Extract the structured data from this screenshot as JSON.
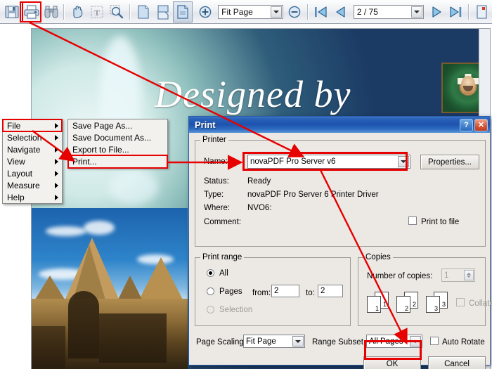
{
  "toolbar": {
    "icons": [
      {
        "name": "save-icon",
        "title": "Save"
      },
      {
        "name": "print-icon",
        "title": "Print"
      },
      {
        "name": "find-binoculars-icon",
        "title": "Find"
      },
      {
        "name": "hand-pan-icon",
        "title": "Pan"
      },
      {
        "name": "text-select-icon",
        "title": "Select Text"
      },
      {
        "name": "zoom-marquee-icon",
        "title": "Zoom"
      },
      {
        "name": "page-view-icon",
        "title": "Single Page"
      },
      {
        "name": "continuous-view-icon",
        "title": "Continuous"
      },
      {
        "name": "facing-view-icon",
        "title": "Facing"
      },
      {
        "name": "zoom-in-icon",
        "title": "Zoom In"
      },
      {
        "name": "zoom-out-icon",
        "title": "Zoom Out"
      },
      {
        "name": "first-page-icon",
        "title": "First Page"
      },
      {
        "name": "previous-page-icon",
        "title": "Previous Page"
      },
      {
        "name": "next-page-icon",
        "title": "Next Page"
      },
      {
        "name": "last-page-icon",
        "title": "Last Page"
      }
    ],
    "zoom_value": "Fit Page",
    "page_value": "2 / 75"
  },
  "document": {
    "heading": "Designed by"
  },
  "context_menu": {
    "main_items": [
      {
        "label": "File",
        "has_submenu": true,
        "highlighted": true
      },
      {
        "label": "Selection",
        "has_submenu": true,
        "highlighted": false
      },
      {
        "label": "Navigate",
        "has_submenu": true,
        "highlighted": false
      },
      {
        "label": "View",
        "has_submenu": true,
        "highlighted": false
      },
      {
        "label": "Layout",
        "has_submenu": true,
        "highlighted": false
      },
      {
        "label": "Measure",
        "has_submenu": true,
        "highlighted": false
      },
      {
        "label": "Help",
        "has_submenu": true,
        "highlighted": false
      }
    ],
    "sub_items": [
      {
        "label": "Save Page As...",
        "highlighted": false
      },
      {
        "label": "Save Document As...",
        "highlighted": false
      },
      {
        "label": "Export to File...",
        "highlighted": false
      },
      {
        "label": "Print...",
        "highlighted": true
      }
    ]
  },
  "dialog": {
    "title": "Print",
    "help_button": "?",
    "close_button": "✕",
    "printer": {
      "legend": "Printer",
      "name_label": "Name:",
      "name_value": "novaPDF Pro Server v6",
      "properties_button": "Properties...",
      "status_label": "Status:",
      "status_value": "Ready",
      "type_label": "Type:",
      "type_value": "novaPDF Pro Server 6 Printer Driver",
      "where_label": "Where:",
      "where_value": "NVO6:",
      "comment_label": "Comment:",
      "comment_value": "",
      "print_to_file_label": "Print to file",
      "print_to_file_checked": false
    },
    "print_range": {
      "legend": "Print range",
      "all_label": "All",
      "all_selected": true,
      "pages_label": "Pages",
      "pages_selected": false,
      "from_label": "from:",
      "from_value": "2",
      "to_label": "to:",
      "to_value": "2",
      "selection_label": "Selection",
      "selection_selected": false,
      "selection_disabled": true
    },
    "copies": {
      "legend": "Copies",
      "number_label": "Number of copies:",
      "number_value": "1",
      "number_disabled": true,
      "collate_label": "Collate",
      "collate_checked": false,
      "collate_disabled": true,
      "sheet_numbers": [
        "1",
        "1",
        "2",
        "2",
        "3",
        "3"
      ]
    },
    "bottom": {
      "page_scaling_label": "Page Scaling",
      "page_scaling_value": "Fit Page",
      "range_subset_label": "Range Subset",
      "range_subset_value": "All Pages",
      "auto_rotate_label": "Auto Rotate",
      "auto_rotate_checked": false,
      "ok_button": "OK",
      "cancel_button": "Cancel"
    }
  },
  "annotations": {
    "accent_color": "#e60000",
    "highlights": [
      {
        "name": "print-toolbar-button-highlight"
      },
      {
        "name": "file-menu-item-highlight"
      },
      {
        "name": "print-menu-item-highlight"
      },
      {
        "name": "printer-name-combo-highlight"
      },
      {
        "name": "ok-button-highlight"
      }
    ]
  }
}
